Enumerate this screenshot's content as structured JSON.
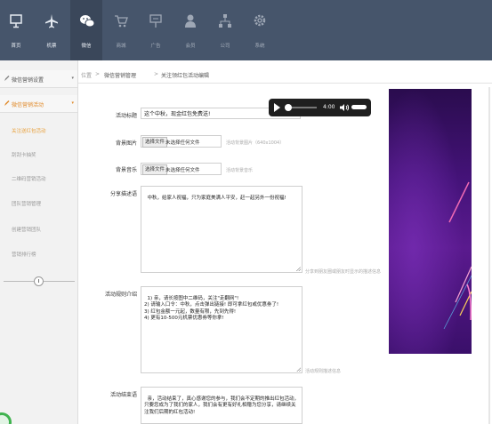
{
  "nav": {
    "items": [
      {
        "label": "首页",
        "icon": "monitor-icon"
      },
      {
        "label": "机票",
        "icon": "plane-icon"
      },
      {
        "label": "微信",
        "icon": "wechat-icon"
      },
      {
        "label": "商城",
        "icon": "cart-icon"
      },
      {
        "label": "广告",
        "icon": "billboard-icon"
      },
      {
        "label": "会员",
        "icon": "user-icon"
      },
      {
        "label": "公司",
        "icon": "org-chart-icon"
      },
      {
        "label": "系统",
        "icon": "gear-icon"
      }
    ],
    "active_index": 2
  },
  "sidebar": {
    "group1": "微信营销设置",
    "group2": "微信营销活动",
    "links": [
      "关注送红包活动",
      "刮刮卡抽奖",
      "二维码营销活动",
      "团队营销管理",
      "创建营销团队",
      "营销排行榜"
    ],
    "active_link": 0
  },
  "breadcrumb": {
    "location": "位置",
    "level1": "微信营销管理",
    "level2": "关注领红包活动编辑"
  },
  "form": {
    "title_label": "活动标题",
    "title_value": "这个中秋，现金红包免费送!",
    "bg_image_label": "背景图片",
    "bg_image_hint": "活动背景图片（640x1004）",
    "bg_music_label": "背景音乐",
    "bg_music_hint": "活动背景音乐",
    "file_button": "选择文件",
    "file_none": "未选择任何文件",
    "share_label": "分享描述语",
    "share_value": "中秋，给家人祝福，只为家庭美满人平安，赶一起另外一份祝福!",
    "share_hint": "分享到朋友圈或朋友时显示的描述信息",
    "rules_label": "活动规则介绍",
    "rules_value": "1) 亲，请长按图中二维码，关注\"走翻网\"!\n2) 请输入口令：中秋，点击弹出链接! 即可拿红包或优惠劵了!\n3) 红包金额一元起，数量有限，先到先得!\n4) 更有10-500元机票优惠券等你拿!",
    "rules_hint": "活动规则描述信息",
    "end_label": "活动结束语",
    "end_value": "亲，活动结束了，真心感谢您的参与，我们会不定期的推出红包活动，只要您成为了我们的家人，我们会有更有好礼相赠为您分享，请继续关注我们后期的红包活动!"
  },
  "audio": {
    "time": "4:00"
  }
}
